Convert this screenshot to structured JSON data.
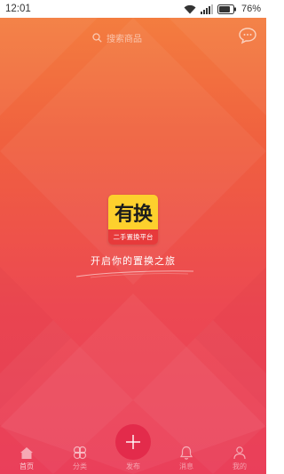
{
  "statusbar": {
    "time": "12:01",
    "battery_percent": "76%",
    "icons": [
      "wifi-icon",
      "signal-icon",
      "battery-icon"
    ]
  },
  "search": {
    "placeholder": "搜索商品",
    "icon": "search-icon"
  },
  "chat_icon": "chat-bubble-icon",
  "logo": {
    "title": "有换",
    "subtitle": "二手置换平台"
  },
  "slogan": "开启你的置换之旅",
  "tabbar": {
    "items": [
      {
        "label": "首页",
        "icon": "home-icon"
      },
      {
        "label": "分类",
        "icon": "category-icon"
      },
      {
        "label": "发布",
        "icon": "plus-icon"
      },
      {
        "label": "消息",
        "icon": "bell-icon"
      },
      {
        "label": "我的",
        "icon": "user-icon"
      }
    ]
  },
  "colors": {
    "gradient_top": "#f4813f",
    "gradient_bottom": "#ea3f5a",
    "logo_yellow": "#fdd02d",
    "logo_red": "#e73a3b"
  }
}
